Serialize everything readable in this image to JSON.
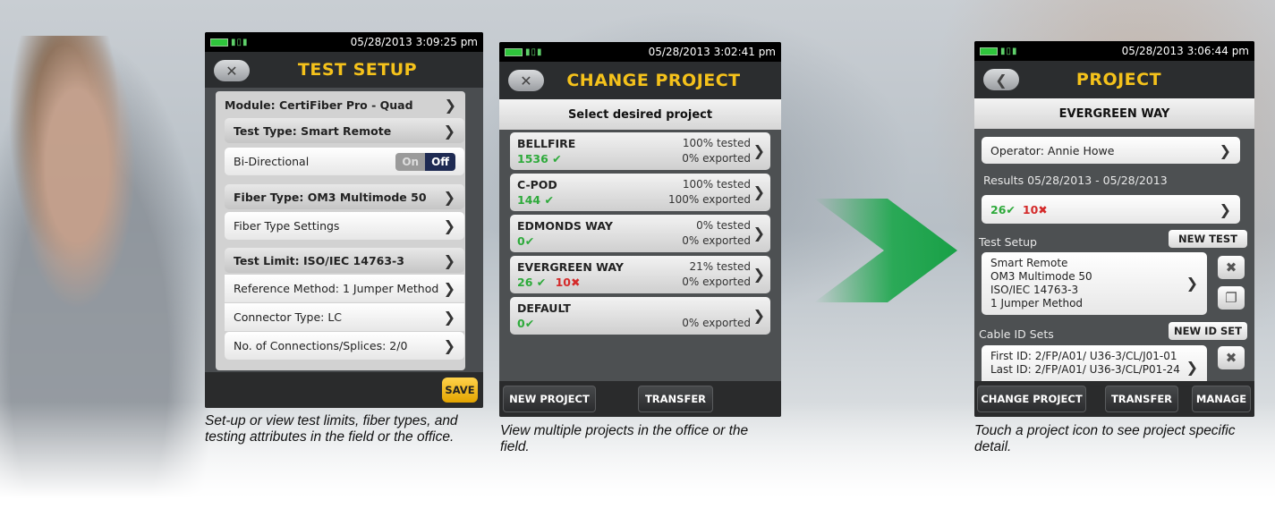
{
  "screen1": {
    "time": "05/28/2013 3:09:25 pm",
    "title": "TEST SETUP",
    "rows": [
      {
        "label": "Module: CertiFiber Pro - Quad"
      },
      {
        "label": "Test Type: Smart Remote"
      },
      {
        "label": "Bi-Directional"
      },
      {
        "label": "Fiber Type: OM3 Multimode 50"
      },
      {
        "label": "Fiber Type Settings"
      },
      {
        "label": "Test Limit: ISO/IEC 14763-3"
      },
      {
        "label": "Reference Method: 1 Jumper Method"
      },
      {
        "label": "Connector Type: LC"
      },
      {
        "label": "No. of Connections/Splices: 2/0"
      }
    ],
    "toggle_on": "On",
    "toggle_off": "Off",
    "save_label": "SAVE",
    "caption": "Set-up or view test limits, fiber types, and testing attributes in the field or the office."
  },
  "screen2": {
    "time": "05/28/2013 3:02:41 pm",
    "title": "CHANGE PROJECT",
    "subtitle": "Select desired project",
    "projects": [
      {
        "name": "BELLFIRE",
        "pass": "1536",
        "fail": "",
        "tested": "100% tested",
        "exported": "0% exported"
      },
      {
        "name": "C-POD",
        "pass": "144",
        "fail": "",
        "tested": "100% tested",
        "exported": "100% exported"
      },
      {
        "name": "EDMONDS WAY",
        "pass": "0",
        "fail": "",
        "tested": "0% tested",
        "exported": "0% exported"
      },
      {
        "name": "EVERGREEN WAY",
        "pass": "26",
        "fail": "10",
        "tested": "21% tested",
        "exported": "0% exported"
      },
      {
        "name": "DEFAULT",
        "pass": "0",
        "fail": "",
        "tested": "",
        "exported": "0% exported"
      }
    ],
    "new_project_label": "NEW PROJECT",
    "transfer_label": "TRANSFER",
    "caption": "View multiple projects in the office or the field."
  },
  "screen3": {
    "time": "05/28/2013 3:06:44 pm",
    "title": "PROJECT",
    "subtitle": "EVERGREEN WAY",
    "operator": "Operator: Annie Howe",
    "results_label": "Results 05/28/2013 - 05/28/2013",
    "pass_count": "26",
    "fail_count": "10",
    "test_setup_label": "Test Setup",
    "new_test_label": "NEW TEST",
    "test_setup_lines": [
      "Smart Remote",
      "OM3 Multimode 50",
      "ISO/IEC 14763-3",
      "1 Jumper Method"
    ],
    "cable_id_label": "Cable ID Sets",
    "new_id_set_label": "NEW ID SET",
    "first_id": "First ID: 2/FP/A01/ U36-3/CL/J01-01",
    "last_id": "Last ID: 2/FP/A01/ U36-3/CL/P01-24",
    "change_project_label": "CHANGE PROJECT",
    "transfer_label": "TRANSFER",
    "manage_label": "MANAGE",
    "caption": "Touch a project icon to see project specific detail."
  },
  "colors": {
    "title_yellow": "#f5c21b",
    "pass_green": "#2eaa3b",
    "fail_red": "#d42a2a",
    "arrow_green": "#1aa64a"
  }
}
